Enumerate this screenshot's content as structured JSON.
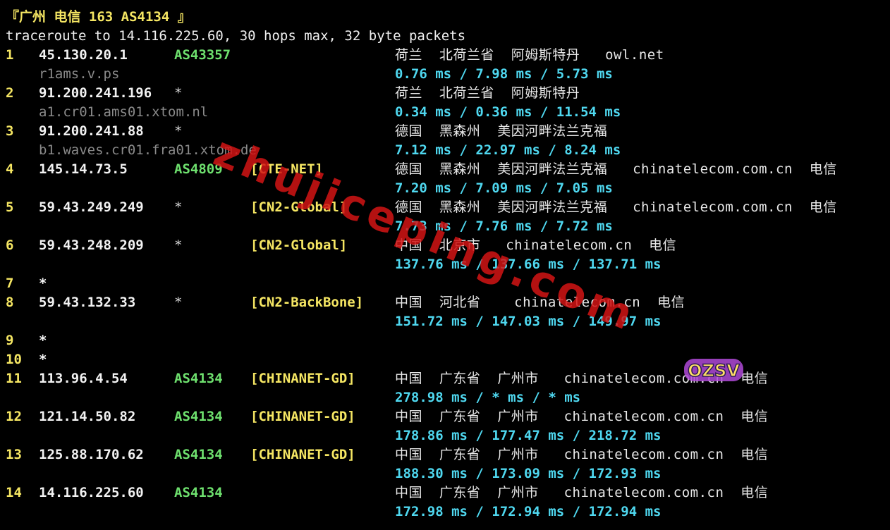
{
  "title": "『广州 电信 163 AS4134 』",
  "command": "traceroute to 14.116.225.60, 30 hops max, 32 byte packets",
  "hops": [
    {
      "hop": "1",
      "ip": "45.130.20.1",
      "asn": "AS43357",
      "tag": "",
      "geo": "荷兰  北荷兰省  阿姆斯特丹   owl.net",
      "host": "r1ams.v.ps",
      "rtt": "0.76 ms / 7.98 ms / 5.73 ms"
    },
    {
      "hop": "2",
      "ip": "91.200.241.196",
      "asn": "*",
      "tag": "",
      "geo": "荷兰  北荷兰省  阿姆斯特丹",
      "host": "a1.cr01.ams01.xtom.nl",
      "rtt": "0.34 ms / 0.36 ms / 11.54 ms"
    },
    {
      "hop": "3",
      "ip": "91.200.241.88",
      "asn": "*",
      "tag": "",
      "geo": "德国  黑森州  美因河畔法兰克福",
      "host": "b1.waves.cr01.fra01.xtom.de",
      "rtt": "7.12 ms / 22.97 ms / 8.24 ms"
    },
    {
      "hop": "4",
      "ip": "145.14.73.5",
      "asn": "AS4809",
      "tag": "[CTE-NET]",
      "geo": "德国  黑森州  美因河畔法兰克福   chinatelecom.com.cn  电信",
      "host": "",
      "rtt": "7.20 ms / 7.09 ms / 7.05 ms"
    },
    {
      "hop": "5",
      "ip": "59.43.249.249",
      "asn": "*",
      "tag": "[CN2-Global]",
      "geo": "德国  黑森州  美因河畔法兰克福   chinatelecom.com.cn  电信",
      "host": "",
      "rtt": "7.73 ms / 7.76 ms / 7.72 ms"
    },
    {
      "hop": "6",
      "ip": "59.43.248.209",
      "asn": "*",
      "tag": "[CN2-Global]",
      "geo": "中国  北京市   chinatelecom.cn  电信",
      "host": "",
      "rtt": "137.76 ms / 137.66 ms / 137.71 ms"
    },
    {
      "hop": "7",
      "star": "*"
    },
    {
      "hop": "8",
      "ip": "59.43.132.33",
      "asn": "*",
      "tag": "[CN2-BackBone]",
      "geo": "中国  河北省    chinatelecom.cn  电信",
      "host": "",
      "rtt": "151.72 ms / 147.03 ms / 149.97 ms"
    },
    {
      "hop": "9",
      "star": "*"
    },
    {
      "hop": "10",
      "star": "*"
    },
    {
      "hop": "11",
      "ip": "113.96.4.54",
      "asn": "AS4134",
      "tag": "[CHINANET-GD]",
      "geo": "中国  广东省  广州市   chinatelecom.com.cn  电信",
      "host": "",
      "rtt": "278.98 ms / * ms / * ms"
    },
    {
      "hop": "12",
      "ip": "121.14.50.82",
      "asn": "AS4134",
      "tag": "[CHINANET-GD]",
      "geo": "中国  广东省  广州市   chinatelecom.com.cn  电信",
      "host": "",
      "rtt": "178.86 ms / 177.47 ms / 218.72 ms"
    },
    {
      "hop": "13",
      "ip": "125.88.170.62",
      "asn": "AS4134",
      "tag": "[CHINANET-GD]",
      "geo": "中国  广东省  广州市   chinatelecom.com.cn  电信",
      "host": "",
      "rtt": "188.30 ms / 173.09 ms / 172.93 ms"
    },
    {
      "hop": "14",
      "ip": "14.116.225.60",
      "asn": "AS4134",
      "tag": "",
      "geo": "中国  广东省  广州市   chinatelecom.com.cn  电信",
      "host": "",
      "rtt": "172.98 ms / 172.94 ms / 172.94 ms"
    }
  ],
  "watermark": "zhujiceping.com",
  "badge": "OZSV"
}
